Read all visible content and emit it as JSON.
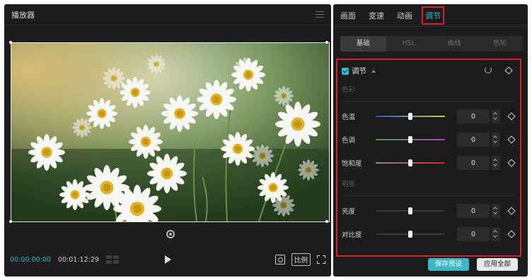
{
  "player": {
    "title": "播放器",
    "timecode_current": "00:00:00:00",
    "timecode_total": "00:01:12:29",
    "ratio_label": "比例"
  },
  "panel": {
    "tabs": [
      {
        "label": "画面",
        "active": false
      },
      {
        "label": "变速",
        "active": false
      },
      {
        "label": "动画",
        "active": false
      },
      {
        "label": "调节",
        "active": true
      }
    ],
    "subtabs": [
      {
        "label": "基础",
        "active": true
      },
      {
        "label": "HSL",
        "active": false
      },
      {
        "label": "曲线",
        "active": false
      },
      {
        "label": "色轮",
        "active": false
      }
    ],
    "adjust": {
      "title": "调节",
      "enabled": true,
      "section_color": "色彩",
      "section_light": "明度",
      "rows": [
        {
          "label": "色温",
          "value": "0",
          "knob_pct": 50,
          "track": "linear-gradient(90deg,#3550c8,#c8d040)"
        },
        {
          "label": "色调",
          "value": "0",
          "knob_pct": 50,
          "track": "linear-gradient(90deg,#3fa040,#b040c0)"
        },
        {
          "label": "饱和度",
          "value": "0",
          "knob_pct": 50,
          "track": "linear-gradient(90deg,#8a8a8a,#d02828)"
        },
        {
          "label": "亮度",
          "value": "0",
          "knob_pct": 50,
          "track": "#3a3a3c"
        },
        {
          "label": "对比度",
          "value": "0",
          "knob_pct": 50,
          "track": "#3a3a3c"
        }
      ]
    },
    "buttons": {
      "save_preset": "保存预设",
      "apply_all": "应用全部"
    }
  },
  "colors": {
    "accent": "#3fb6c7",
    "highlight_box": "#d6232b",
    "panel_bg": "#1c1c1e"
  }
}
